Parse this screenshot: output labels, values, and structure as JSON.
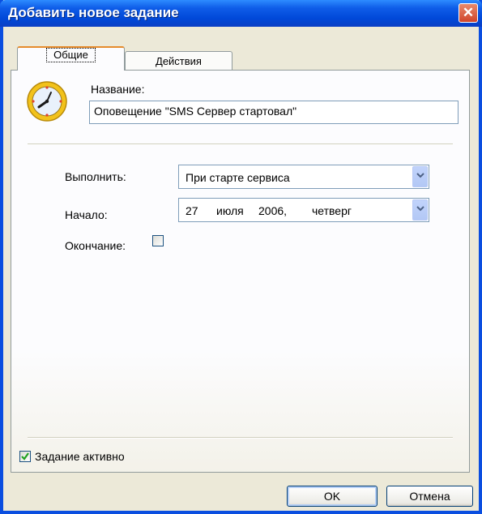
{
  "window": {
    "title": "Добавить новое задание",
    "close_symbol": "✕"
  },
  "tabs": [
    {
      "label": "Общие",
      "active": true
    },
    {
      "label": "Действия",
      "active": false
    }
  ],
  "general": {
    "icon": "clock-icon",
    "name_label": "Название:",
    "name_value": "Оповещение \"SMS Сервер стартовал\"",
    "execute_label": "Выполнить:",
    "execute_value": "При старте сервиса",
    "start_label": "Начало:",
    "start_day": "27",
    "start_month": "июля",
    "start_year": "2006,",
    "start_weekday": "четверг",
    "end_label": "Окончание:",
    "end_checked": false,
    "active_label": "Задание активно",
    "active_checked": true
  },
  "buttons": {
    "ok": "OK",
    "cancel": "Отмена"
  },
  "colors": {
    "title_bar": "#0048d8",
    "dialog_bg": "#ece9d8",
    "tab_accent": "#e68b2c"
  }
}
